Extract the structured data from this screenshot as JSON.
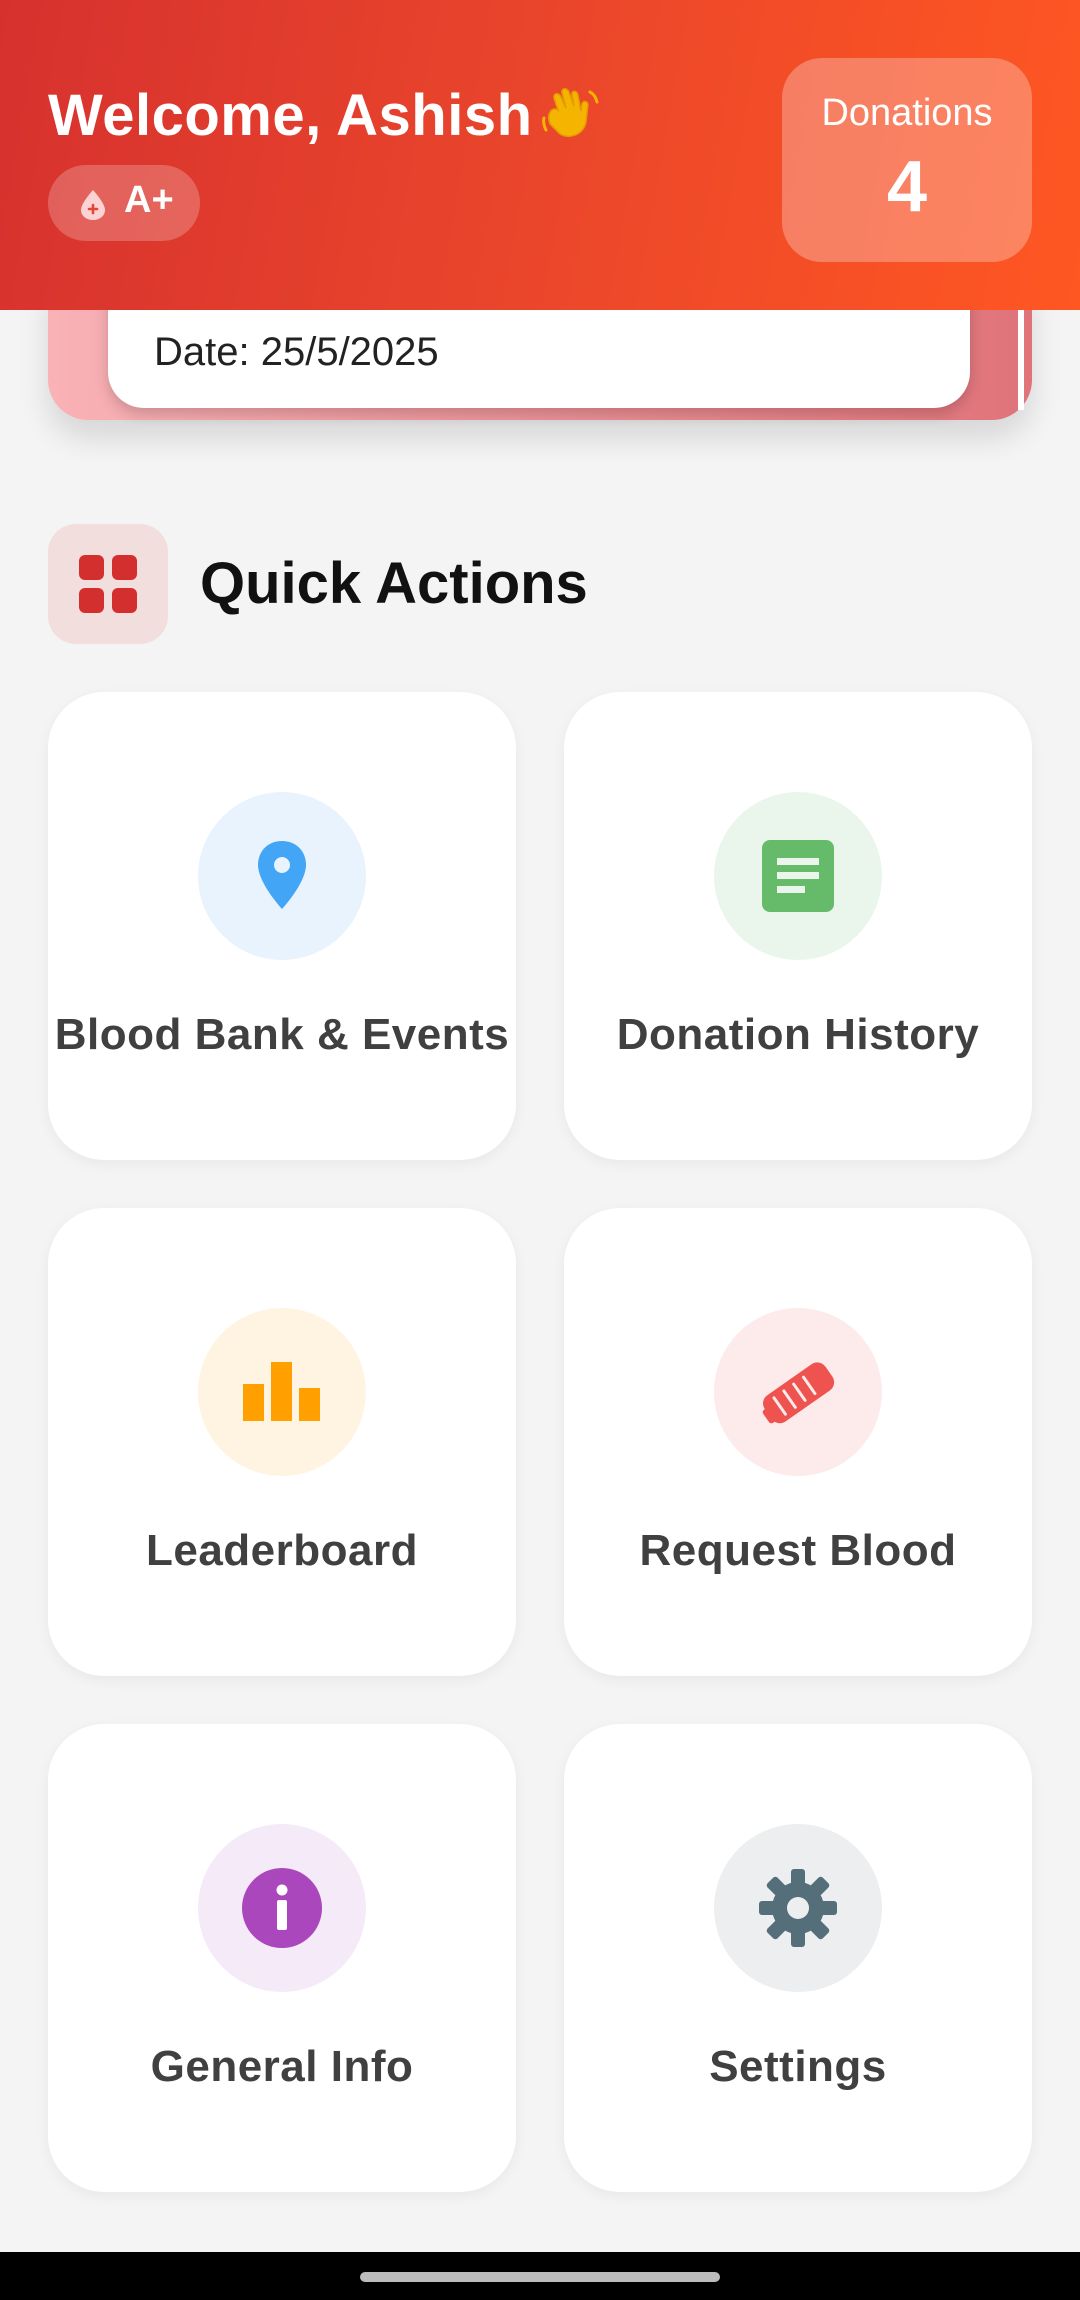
{
  "header": {
    "welcome": "Welcome, Ashish",
    "wave_icon": "waving-hand-icon",
    "blood_group": "A+",
    "donations_label": "Donations",
    "donations_count": "4"
  },
  "event_card": {
    "date": "Date: 25/5/2025"
  },
  "quick_actions": {
    "title": "Quick Actions",
    "icon": "grid-icon",
    "items": [
      {
        "label": "Blood Bank & Events",
        "icon": "location-pin-icon",
        "color": "#42a5f5",
        "bg": "#e8f3fd"
      },
      {
        "label": "Donation History",
        "icon": "document-icon",
        "color": "#66bb6a",
        "bg": "#eaf5ec"
      },
      {
        "label": "Leaderboard",
        "icon": "bar-chart-icon",
        "color": "#ffa000",
        "bg": "#fff4e2"
      },
      {
        "label": "Request Blood",
        "icon": "handshake-icon",
        "color": "#ef5350",
        "bg": "#fdeaea"
      },
      {
        "label": "General Info",
        "icon": "info-icon",
        "color": "#ab47bc",
        "bg": "#f5eaf7"
      },
      {
        "label": "Settings",
        "icon": "gear-icon",
        "color": "#546e7a",
        "bg": "#eceef0"
      }
    ]
  },
  "colors": {
    "header_start": "#d7312e",
    "header_end": "#ff5722",
    "accent": "#d32f2f"
  }
}
